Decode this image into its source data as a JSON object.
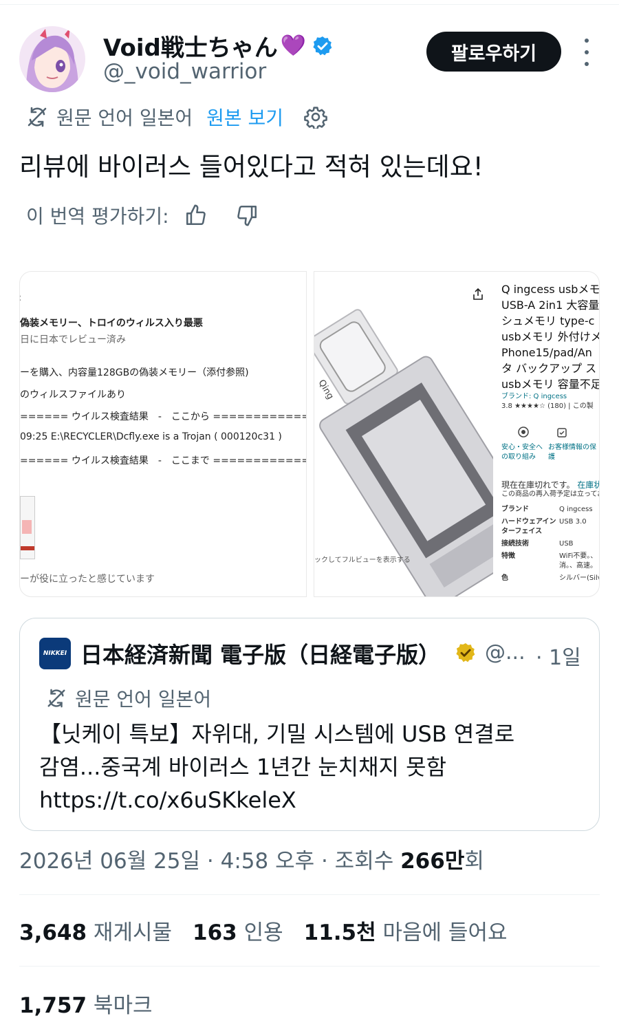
{
  "author": {
    "name": "Void戦士ちゃん",
    "emoji": "💜",
    "handle": "@_void_warrior",
    "verified_icon": "verified-badge-icon"
  },
  "header": {
    "follow_label": "팔로우하기",
    "more_icon": "more-vertical-icon"
  },
  "translation": {
    "info": "원문 언어 일본어",
    "show_original": "원본 보기",
    "settings_icon": "gear-icon"
  },
  "tweet": {
    "text": "리뷰에 바이러스 들어있다고 적혀 있는데요!"
  },
  "rating": {
    "label": "이 번역 평가하기:",
    "up_icon": "thumbs-up-icon",
    "down_icon": "thumbs-down-icon"
  },
  "media": {
    "review": {
      "title": "偽装メモリー、トロイのウィルス入り最悪",
      "date": "日に日本でレビュー済み",
      "line1": "ーを購入、内容量128GBの偽装メモリー（添付参照)",
      "line2": "のウィルスファイルあり",
      "line3": "====== ウイルス検査結果　-　ここから ==============",
      "line4": "09:25 E:\\RECYCLER\\Dcfly.exe is a Trojan ( 000120c31 )",
      "line5": "====== ウイルス検査結果　-　ここまで ==============",
      "footer": "ーが役に立ったと感じています"
    },
    "product": {
      "title_lines": [
        "Q ingcess usbメモ",
        "USB-A 2in1 大容量",
        "シュメモリ type-c",
        "usbメモリ 外付けメ",
        "Phone15/pad/An",
        "タ バックアップ ス",
        "usbメモリ 容量不足"
      ],
      "brand_link": "ブランド: Q ingcess",
      "rating": "3.8 ★★★★☆ (180) | この製",
      "safety": "安心・安全への取り組み",
      "privacy": "お客様情報の保護",
      "stock": "現在在庫切れです。",
      "stock_link": "在庫状",
      "restock": "この商品の再入荷予定は立っておりません",
      "specs": [
        {
          "k": "ブランド",
          "v": "Q ingcess"
        },
        {
          "k": "ハードウェアインターフェイス",
          "v": "USB 3.0"
        },
        {
          "k": "接続技術",
          "v": "USB"
        },
        {
          "k": "特徴",
          "v": "WiFi不要。、消。、高速。"
        },
        {
          "k": "色",
          "v": "シルバー(Silv"
        }
      ],
      "zoom_hint": "ックしてフルビューを表示する",
      "brand_on_device": "Qing",
      "share_icon": "share-icon"
    }
  },
  "quoted": {
    "logo_text": "NIKKEI",
    "name": "日本経済新聞 電子版（日経電子版）",
    "badge_icon": "gold-verified-badge-icon",
    "handle": "@...",
    "time": "· 1일",
    "translation_info": "원문 언어 일본어",
    "text_line1": "【닛케이 특보】자위대, 기밀 시스템에 USB 연결로",
    "text_line2": "감염...중국계 바이러스 1년간 눈치채지 못함",
    "text_line3": "https://t.co/x6uSKkeleX"
  },
  "meta": {
    "datetime": "2026년 06월 25일 · 4:58 오후 · 조회수 ",
    "views": "266만",
    "views_suffix": "회"
  },
  "stats": {
    "reposts": "3,648",
    "reposts_label": "재게시물",
    "quotes": "163",
    "quotes_label": "인용",
    "likes": "11.5천",
    "likes_label": "마음에 들어요",
    "bookmarks": "1,757",
    "bookmarks_label": "북마크"
  },
  "colors": {
    "accent": "#1d9bf0",
    "text": "#0f1419",
    "secondary": "#536471",
    "follow_bg": "#0f1419",
    "nikkei": "#0b3a7a",
    "gold_badge": "#e2b719"
  }
}
